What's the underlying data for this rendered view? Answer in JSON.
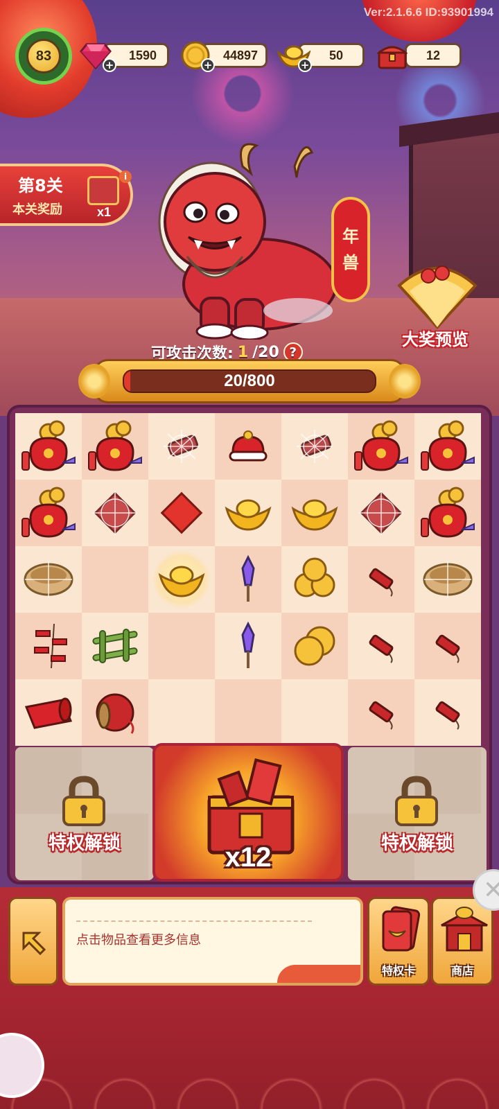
{
  "header": {
    "version": "Ver:2.1.6.6 ID:93901994",
    "player_level": "83",
    "resources": [
      {
        "icon": "gem-icon",
        "value": "1590"
      },
      {
        "icon": "gold-coin-icon",
        "value": "44897"
      },
      {
        "icon": "gold-ingot-icon",
        "value": "50"
      },
      {
        "icon": "treasure-chest-icon",
        "value": "12"
      }
    ]
  },
  "level_panel": {
    "title": "第8关",
    "subtitle": "本关奖励",
    "reward_count": "x1"
  },
  "boss": {
    "name_line1": "年",
    "name_line2": "兽",
    "attacks_label": "可攻击次数:",
    "attacks_current": "1",
    "attacks_total": "/20",
    "hp_text": "20/800",
    "hp_current": 20,
    "hp_max": 800
  },
  "prize_preview_label": "大奖预览",
  "board": {
    "rows": [
      [
        "money-bag",
        "money-bag",
        "cobweb-firecracker",
        "red-hat",
        "cobweb-firecracker",
        "money-bag",
        "money-bag"
      ],
      [
        "money-bag",
        "cobweb-red-paper",
        "red-paper",
        "gold-ingot",
        "gold-ingot",
        "cobweb-red-paper",
        "money-bag"
      ],
      [
        "cobweb-basket",
        "",
        "gold-ingot-glow",
        "firework-rocket",
        "coin-pile",
        "firecracker",
        "cobweb-basket"
      ],
      [
        "firecracker-string",
        "bamboo-frame",
        "",
        "firework-rocket",
        "coin-pair",
        "firecracker",
        "firecracker"
      ],
      [
        "red-scroll",
        "thread-spool",
        "",
        "",
        "",
        "firecracker",
        "firecracker"
      ]
    ],
    "left_lock_label": "特权解锁",
    "right_lock_label": "特权解锁",
    "chest_count": "x12"
  },
  "footer": {
    "info_text": "点击物品查看更多信息",
    "privilege_card_label": "特权卡",
    "shop_label": "商店"
  },
  "colors": {
    "accent_red": "#d8232a",
    "gold": "#f4c14a",
    "board_frame": "#7b2d5a"
  }
}
